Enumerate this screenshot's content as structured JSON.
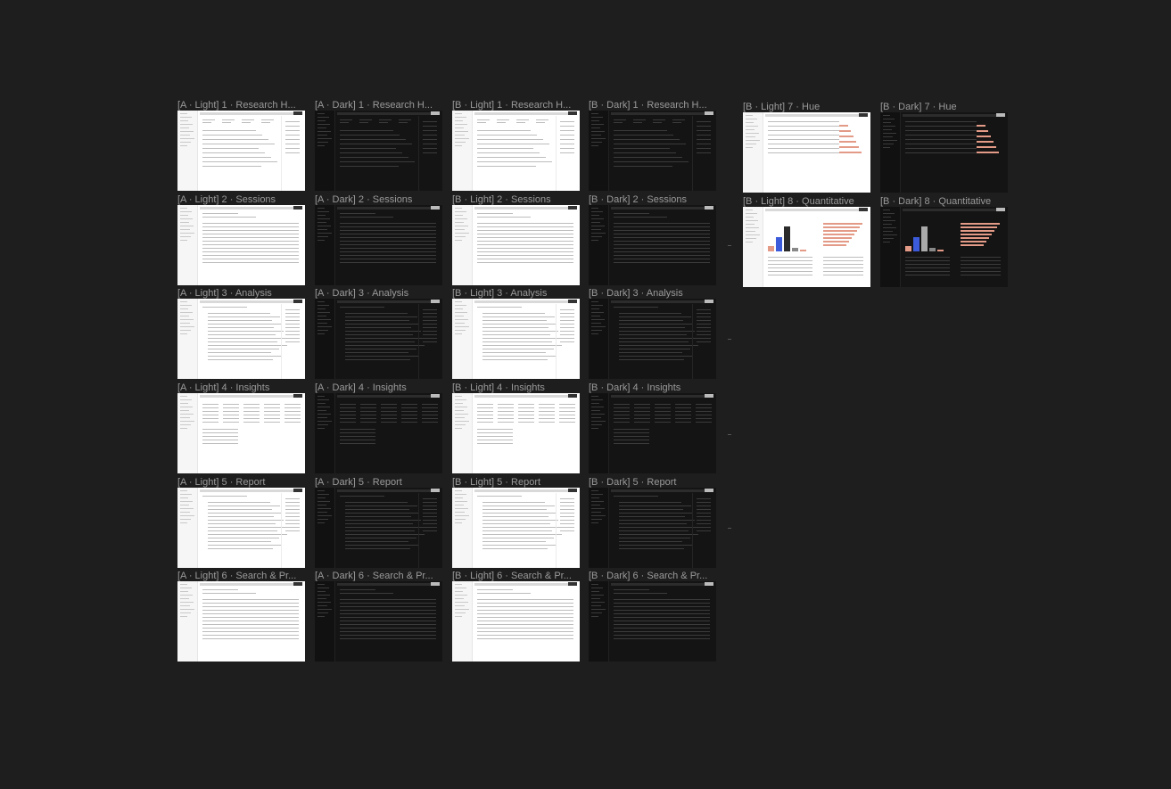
{
  "canvas": {
    "background": "#1e1e1e",
    "frames": [
      {
        "label": "[A · Light] 1 · Research H...",
        "theme": "light",
        "kind": "hub"
      },
      {
        "label": "[A · Dark] 1 · Research H...",
        "theme": "dark",
        "kind": "hub"
      },
      {
        "label": "[B · Light] 1 · Research H...",
        "theme": "light",
        "kind": "hub"
      },
      {
        "label": "[B · Dark] 1 · Research H...",
        "theme": "dark",
        "kind": "hub"
      },
      {
        "label": "[B · Light] 7 · Hue",
        "theme": "light",
        "kind": "hue"
      },
      {
        "label": "[B · Dark] 7 · Hue",
        "theme": "dark",
        "kind": "hue"
      },
      {
        "label": "[A · Light] 2 · Sessions",
        "theme": "light",
        "kind": "table"
      },
      {
        "label": "[A · Dark] 2 · Sessions",
        "theme": "dark",
        "kind": "table"
      },
      {
        "label": "[B · Light] 2 · Sessions",
        "theme": "light",
        "kind": "table"
      },
      {
        "label": "[B · Dark] 2 · Sessions",
        "theme": "dark",
        "kind": "table"
      },
      {
        "label": "[B · Light] 8 · Quantitative",
        "theme": "light",
        "kind": "quant"
      },
      {
        "label": "[B · Dark] 8 · Quantitative",
        "theme": "dark",
        "kind": "quant"
      },
      {
        "label": "[A · Light] 3 · Analysis",
        "theme": "light",
        "kind": "doc"
      },
      {
        "label": "[A · Dark] 3 · Analysis",
        "theme": "dark",
        "kind": "doc"
      },
      {
        "label": "[B · Light] 3 · Analysis",
        "theme": "light",
        "kind": "doc"
      },
      {
        "label": "[B · Dark] 3 · Analysis",
        "theme": "dark",
        "kind": "doc"
      },
      {
        "label": "[A · Light] 4 · Insights",
        "theme": "light",
        "kind": "board"
      },
      {
        "label": "[A · Dark] 4 · Insights",
        "theme": "dark",
        "kind": "board"
      },
      {
        "label": "[B · Light] 4 · Insights",
        "theme": "light",
        "kind": "board"
      },
      {
        "label": "[B · Dark] 4 · Insights",
        "theme": "dark",
        "kind": "board"
      },
      {
        "label": "[A · Light] 5 · Report",
        "theme": "light",
        "kind": "doc"
      },
      {
        "label": "[A · Dark] 5 · Report",
        "theme": "dark",
        "kind": "doc"
      },
      {
        "label": "[B · Light] 5 · Report",
        "theme": "light",
        "kind": "doc"
      },
      {
        "label": "[B · Dark] 5 · Report",
        "theme": "dark",
        "kind": "doc"
      },
      {
        "label": "[A · Light] 6 · Search & Pr...",
        "theme": "light",
        "kind": "table"
      },
      {
        "label": "[A · Dark] 6 · Search & Pr...",
        "theme": "dark",
        "kind": "table"
      },
      {
        "label": "[B · Light] 6 · Search & Pr...",
        "theme": "light",
        "kind": "table"
      },
      {
        "label": "[B · Dark] 6 · Search & Pr...",
        "theme": "dark",
        "kind": "table"
      }
    ]
  }
}
